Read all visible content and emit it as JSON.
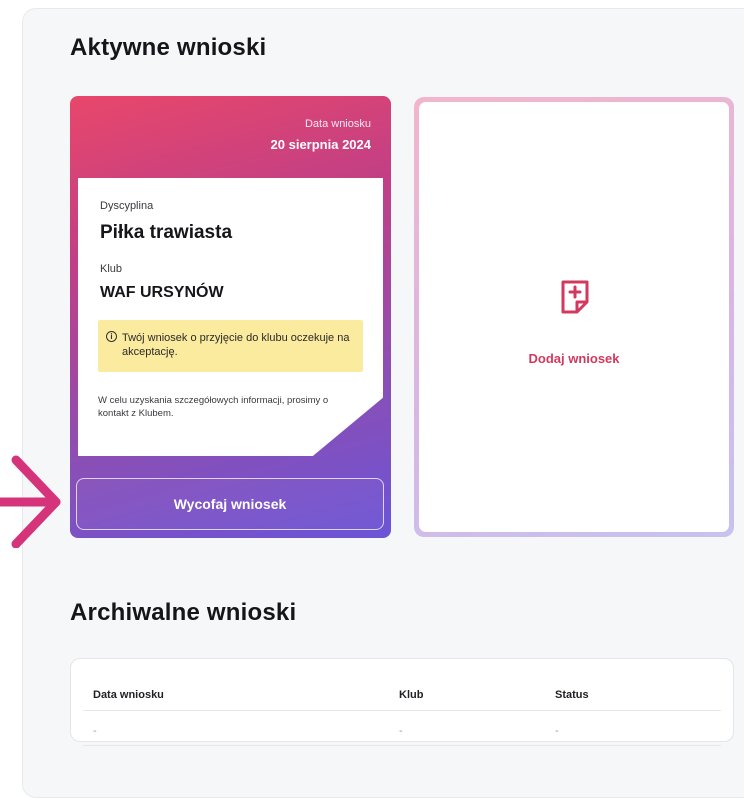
{
  "active_section": {
    "title": "Aktywne wnioski",
    "request_card": {
      "date_label": "Data wniosku",
      "date_value": "20 sierpnia 2024",
      "discipline_label": "Dyscyplina",
      "discipline_value": "Piłka trawiasta",
      "club_label": "Klub",
      "club_value": "WAF URSYNÓW",
      "notice_icon": "i",
      "notice_text": "Twój wniosek o przyjęcie do klubu oczekuje na akceptację.",
      "info_text": "W celu uzyskania szczegółowych informacji, prosimy o kontakt z Klubem.",
      "withdraw_label": "Wycofaj wniosek"
    },
    "add_card": {
      "icon": "add-document-icon",
      "label": "Dodaj wniosek"
    }
  },
  "archive_section": {
    "title": "Archiwalne wnioski",
    "columns": [
      "Data wniosku",
      "Klub",
      "Status"
    ],
    "rows": [
      [
        "-",
        "-",
        "-"
      ]
    ]
  },
  "colors": {
    "accent": "#d13a5e",
    "card_gradient_start": "#e8476a",
    "card_gradient_end": "#6b54d6",
    "notice_bg": "#fbeb9f",
    "arrow": "#d6347a"
  }
}
